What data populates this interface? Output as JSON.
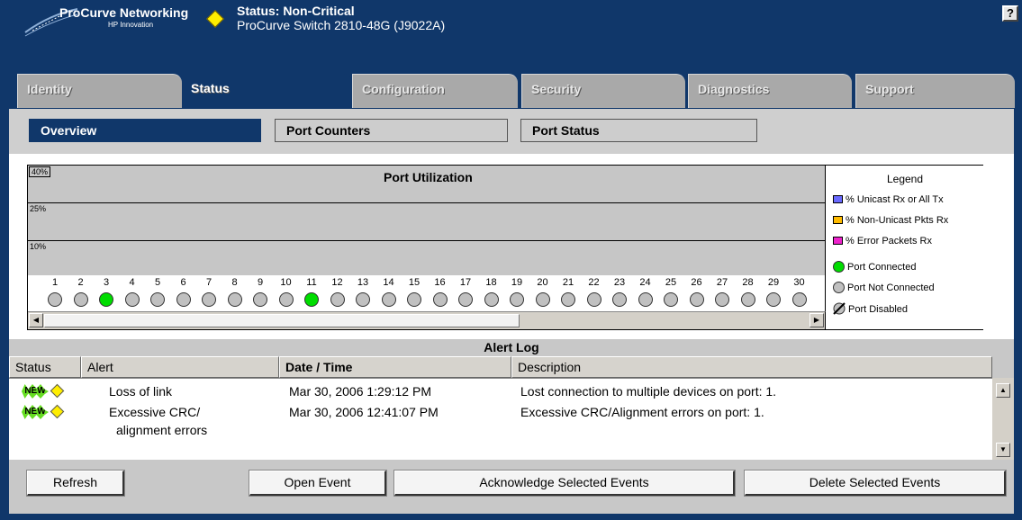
{
  "header": {
    "brand": "ProCurve Networking",
    "brand_sub": "HP Innovation",
    "status_title": "Status: Non-Critical",
    "device": "ProCurve Switch 2810-48G (J9022A)",
    "help_label": "?"
  },
  "tabs": [
    {
      "label": "Identity"
    },
    {
      "label": "Status"
    },
    {
      "label": "Configuration"
    },
    {
      "label": "Security"
    },
    {
      "label": "Diagnostics"
    },
    {
      "label": "Support"
    }
  ],
  "subtabs": [
    {
      "label": "Overview"
    },
    {
      "label": "Port Counters"
    },
    {
      "label": "Port Status"
    }
  ],
  "utilization": {
    "title": "Port Utilization",
    "bands": [
      "40%",
      "25%",
      "10%"
    ],
    "ports": [
      {
        "num": "1",
        "connected": false
      },
      {
        "num": "2",
        "connected": false
      },
      {
        "num": "3",
        "connected": true
      },
      {
        "num": "4",
        "connected": false
      },
      {
        "num": "5",
        "connected": false
      },
      {
        "num": "6",
        "connected": false
      },
      {
        "num": "7",
        "connected": false
      },
      {
        "num": "8",
        "connected": false
      },
      {
        "num": "9",
        "connected": false
      },
      {
        "num": "10",
        "connected": false
      },
      {
        "num": "11",
        "connected": true
      },
      {
        "num": "12",
        "connected": false
      },
      {
        "num": "13",
        "connected": false
      },
      {
        "num": "14",
        "connected": false
      },
      {
        "num": "15",
        "connected": false
      },
      {
        "num": "16",
        "connected": false
      },
      {
        "num": "17",
        "connected": false
      },
      {
        "num": "18",
        "connected": false
      },
      {
        "num": "19",
        "connected": false
      },
      {
        "num": "20",
        "connected": false
      },
      {
        "num": "21",
        "connected": false
      },
      {
        "num": "22",
        "connected": false
      },
      {
        "num": "23",
        "connected": false
      },
      {
        "num": "24",
        "connected": false
      },
      {
        "num": "25",
        "connected": false
      },
      {
        "num": "26",
        "connected": false
      },
      {
        "num": "27",
        "connected": false
      },
      {
        "num": "28",
        "connected": false
      },
      {
        "num": "29",
        "connected": false
      },
      {
        "num": "30",
        "connected": false
      }
    ]
  },
  "legend": {
    "title": "Legend",
    "unicast": "% Unicast Rx or All Tx",
    "nonunicast": "% Non-Unicast Pkts Rx",
    "errors": "% Error Packets Rx",
    "connected": "Port Connected",
    "not_connected": "Port Not Connected",
    "disabled": "Port Disabled",
    "colors": {
      "unicast": "#6a6aff",
      "nonunicast": "#ffbb00",
      "errors": "#ee22cc",
      "connected": "#00dd00",
      "not_connected": "#c0c0c0"
    }
  },
  "alert_log": {
    "title": "Alert Log",
    "columns": [
      "Status",
      "Alert",
      "Date / Time",
      "Description"
    ],
    "new_badge": "NEW",
    "rows": [
      {
        "alert": "Loss of link",
        "alert2": "",
        "datetime": "Mar 30, 2006 1:29:12 PM",
        "description": "Lost connection to multiple devices on port: 1."
      },
      {
        "alert": "Excessive CRC/",
        "alert2": "alignment errors",
        "datetime": "Mar 30, 2006 12:41:07 PM",
        "description": "Excessive CRC/Alignment errors on port: 1."
      }
    ]
  },
  "buttons": {
    "refresh": "Refresh",
    "open": "Open Event",
    "ack": "Acknowledge Selected Events",
    "delete": "Delete Selected Events"
  }
}
